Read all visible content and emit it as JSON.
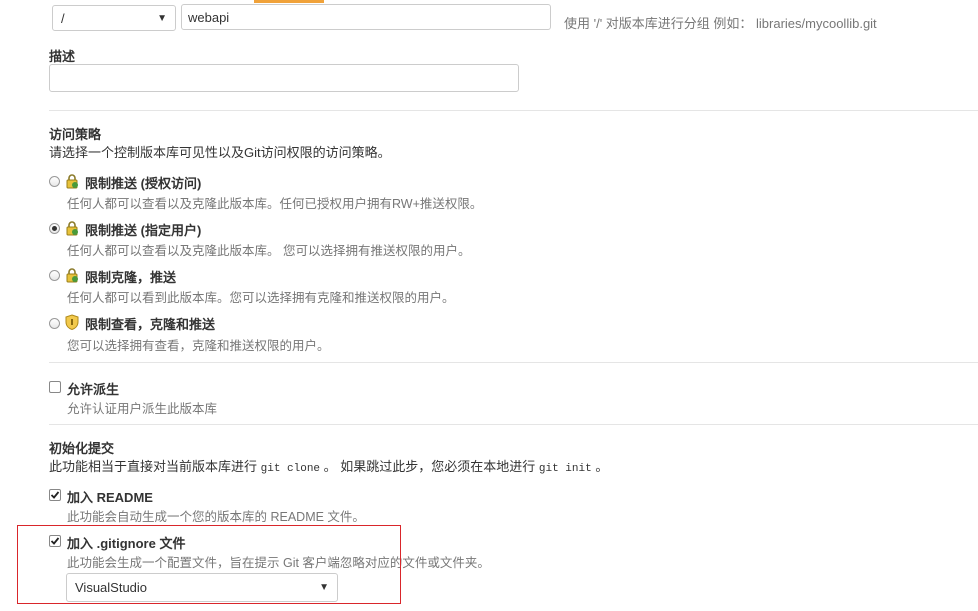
{
  "path": {
    "owner_select_value": "/",
    "repo_name_value": "webapi",
    "hint": "使用 '/' 对版本库进行分组 例如： libraries/mycoollib.git"
  },
  "description": {
    "label": "描述",
    "value": ""
  },
  "access": {
    "title": "访问策略",
    "subtitle": "请选择一个控制版本库可见性以及Git访问权限的访问策略。",
    "options": [
      {
        "label": "限制推送 (授权访问)",
        "desc": "任何人都可以查看以及克隆此版本库。任何已授权用户拥有RW+推送权限。",
        "checked": false,
        "icon": "lock-icon"
      },
      {
        "label": "限制推送 (指定用户)",
        "desc": "任何人都可以查看以及克隆此版本库。 您可以选择拥有推送权限的用户。",
        "checked": true,
        "icon": "lock-icon"
      },
      {
        "label": "限制克隆，推送",
        "desc": "任何人都可以看到此版本库。您可以选择拥有克隆和推送权限的用户。",
        "checked": false,
        "icon": "lock-icon"
      },
      {
        "label": "限制查看，克隆和推送",
        "desc": "您可以选择拥有查看，克隆和推送权限的用户。",
        "checked": false,
        "icon": "shield-icon"
      }
    ]
  },
  "fork": {
    "label": "允许派生",
    "desc": "允许认证用户派生此版本库",
    "checked": false
  },
  "init": {
    "title": "初始化提交",
    "subtitle_pre": "此功能相当于直接对当前版本库进行 ",
    "subtitle_code1": "git clone",
    "subtitle_mid": " 。 如果跳过此步，您必须在本地进行 ",
    "subtitle_code2": "git init",
    "subtitle_post": " 。",
    "readme_label": "加入 README",
    "readme_desc": "此功能会自动生成一个您的版本库的 README 文件。",
    "readme_checked": true,
    "gitignore_label": "加入 .gitignore 文件",
    "gitignore_desc": "此功能会生成一个配置文件，旨在提示 Git 客户端忽略对应的文件或文件夹。",
    "gitignore_checked": true,
    "gitignore_template": "VisualStudio"
  },
  "colors": {
    "accent_tab": "#f0a23a",
    "highlight_border": "#d9262b"
  }
}
